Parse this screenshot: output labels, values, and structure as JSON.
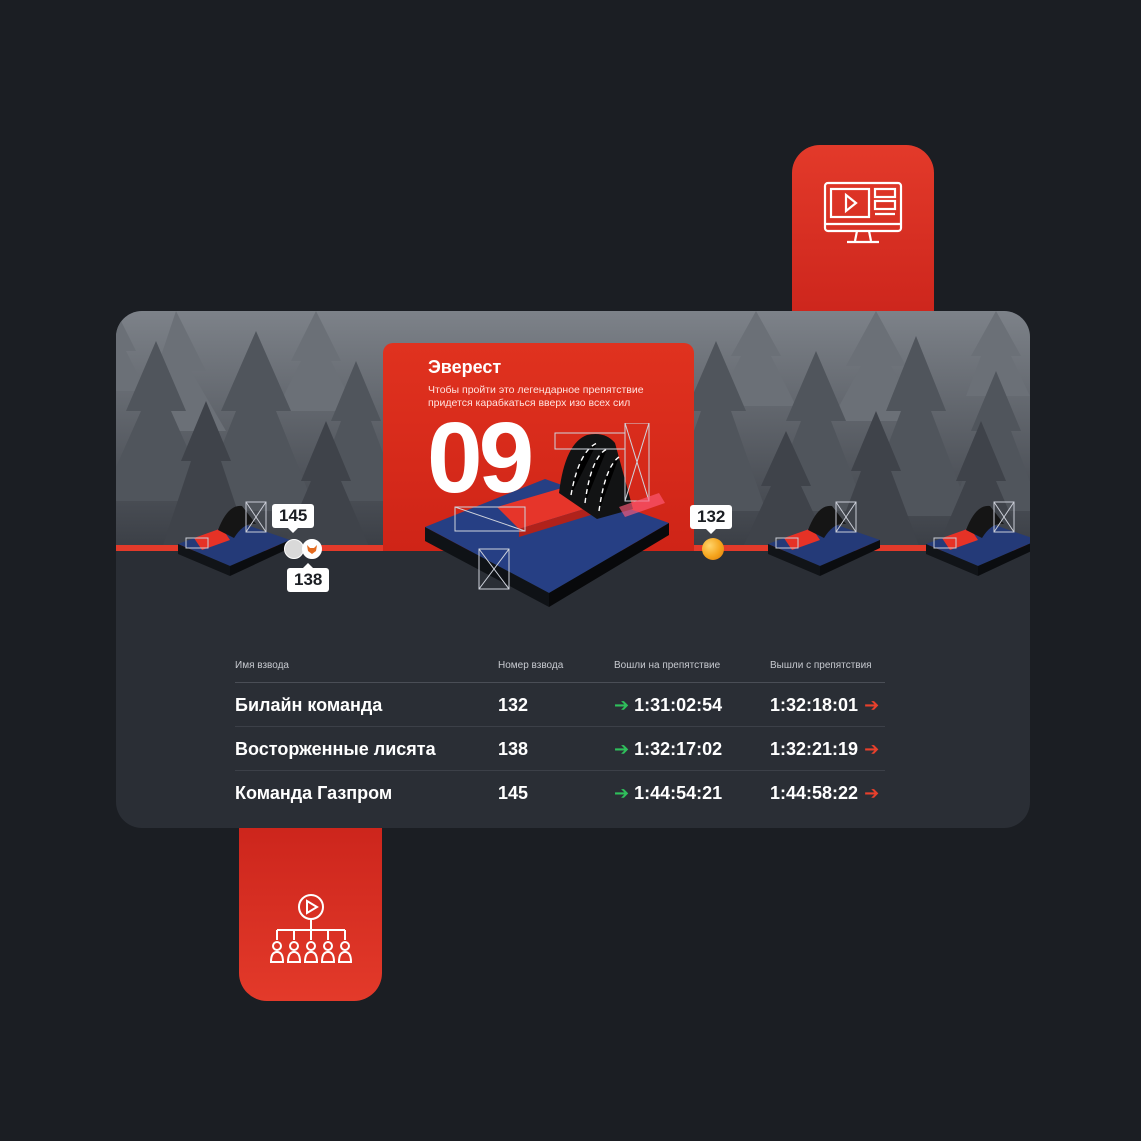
{
  "feature": {
    "title": "Эверест",
    "description": "Чтобы пройти это легендарное препятствие придется карабкаться вверх изо всех сил",
    "number": "09"
  },
  "markers": {
    "tag_145": "145",
    "tag_138": "138",
    "tag_132": "132"
  },
  "table": {
    "headers": [
      "Имя  взвода",
      "Номер взвода",
      "Вошли на препятствие",
      "Вышли с препятствия"
    ],
    "rows": [
      {
        "name": "Билайн команда",
        "number": "132",
        "in": "1:31:02:54",
        "out": "1:32:18:01"
      },
      {
        "name": "Восторженные лисята",
        "number": "138",
        "in": "1:32:17:02",
        "out": "1:32:21:19"
      },
      {
        "name": "Команда Газпром",
        "number": "145",
        "in": "1:44:54:21",
        "out": "1:44:58:22"
      }
    ]
  },
  "icons": {
    "top_tab": "video-monitor-icon",
    "bottom_tab": "play-network-icon",
    "arrow_in": "arrow-right-green-icon",
    "arrow_out": "arrow-right-red-icon"
  },
  "colors": {
    "background": "#1b1e23",
    "card": "#2a2e35",
    "accent": "#e33a2a",
    "in_arrow": "#2fbf5b",
    "out_arrow": "#e8402c"
  }
}
